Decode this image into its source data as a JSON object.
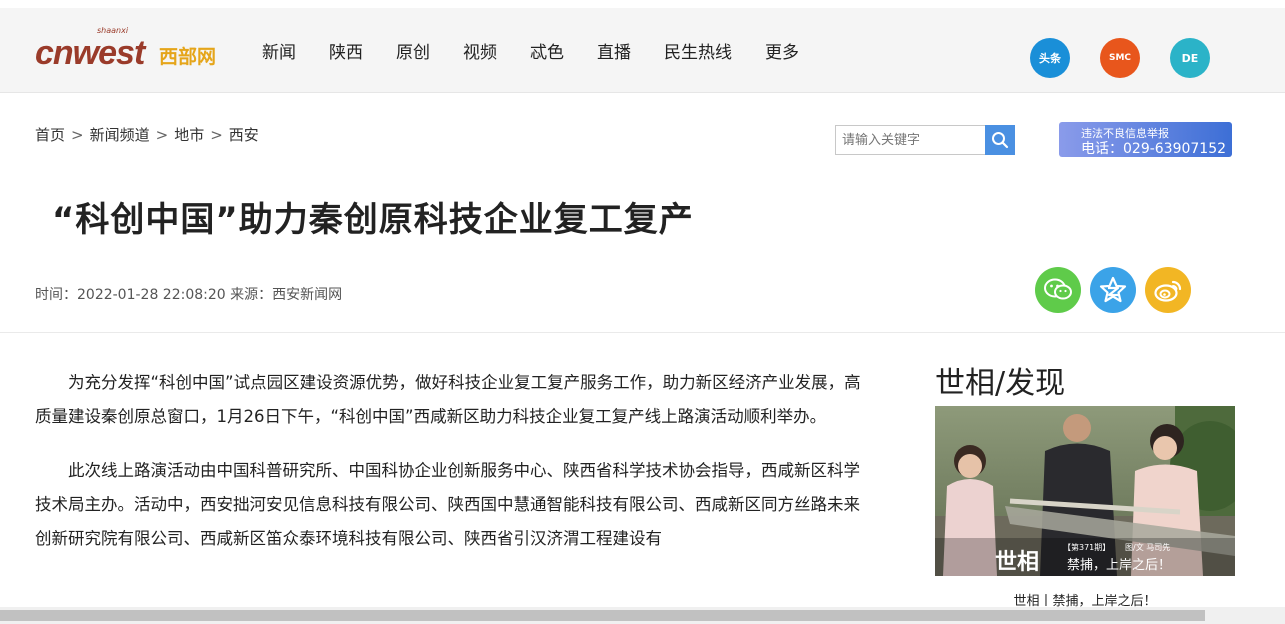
{
  "header": {
    "logo_en": "cnwest",
    "logo_cn": "西部网",
    "logo_tiny": "shaanxi",
    "nav": [
      "新闻",
      "陕西",
      "原创",
      "视频",
      "忒色",
      "直播",
      "民生热线",
      "更多"
    ],
    "apps": [
      {
        "label": "头条",
        "icon": "toutiao-app-icon",
        "color": "#1a8fd8"
      },
      {
        "label": "SMC",
        "icon": "smc-app-icon",
        "color": "#e8561c"
      },
      {
        "label": "DE",
        "icon": "de-app-icon",
        "color": "#2bb3c8"
      }
    ]
  },
  "breadcrumb": [
    "首页",
    "新闻频道",
    "地市",
    "西安"
  ],
  "breadcrumb_sep": ">",
  "search": {
    "placeholder": "请输入关键字"
  },
  "report": {
    "line1": "违法不良信息举报",
    "line2": "电话：029-63907152"
  },
  "article": {
    "title": "“科创中国”助力秦创原科技企业复工复产",
    "meta": "时间：2022-01-28 22:08:20  来源：西安新闻网",
    "paragraphs": [
      "为充分发挥“科创中国”试点园区建设资源优势，做好科技企业复工复产服务工作，助力新区经济产业发展，高质量建设秦创原总窗口，1月26日下午，“科创中国”西咸新区助力科技企业复工复产线上路演活动顺利举办。",
      "此次线上路演活动由中国科普研究所、中国科协企业创新服务中心、陕西省科学技术协会指导，西咸新区科学技术局主办。活动中，西安拙河安见信息科技有限公司、陕西国中慧通智能科技有限公司、西咸新区同方丝路未来创新研究院有限公司、西咸新区笛众泰环境科技有限公司、陕西省引汉济渭工程建设有"
    ]
  },
  "share": [
    "wechat-share-icon",
    "qzone-share-icon",
    "weibo-share-icon"
  ],
  "sidebar": {
    "title": "世相/发现",
    "image_overlay_left": "世相",
    "image_overlay_badge": "【第371期】",
    "image_overlay_text": "禁捕，上岸之后！",
    "image_overlay_credit": "图/文 马司先",
    "caption": "世相丨禁捕，上岸之后！"
  },
  "colors": {
    "accent": "#4a90e2",
    "logo_red": "#9a3b2a",
    "logo_gold": "#e5a51a"
  }
}
